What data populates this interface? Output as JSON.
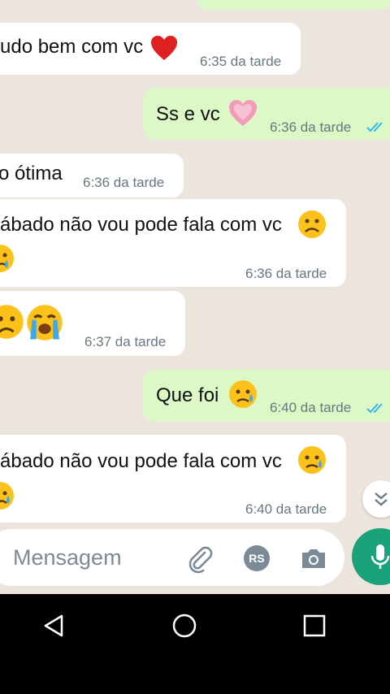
{
  "messages": [
    {
      "direction": "in",
      "text": "udo bem com vc",
      "time": "6:35 da tarde",
      "emoji": "red-heart"
    },
    {
      "direction": "out",
      "text": "Ss e vc",
      "time": "6:36 da tarde",
      "emoji": "growing-heart",
      "status": "read"
    },
    {
      "direction": "in",
      "text": "o ótima",
      "time": "6:36 da tarde"
    },
    {
      "direction": "in",
      "text": "ábado não vou pode fala com vc",
      "time": "6:36 da tarde",
      "emoji": "frowning-face",
      "emoji_line2": "crying-face"
    },
    {
      "direction": "in",
      "text": "",
      "time": "6:37 da tarde",
      "emoji": "sad-face",
      "emoji_2": "loudly-crying-face"
    },
    {
      "direction": "out",
      "text": "Que foi",
      "time": "6:40 da tarde",
      "emoji": "sad-relieved-face",
      "status": "read"
    },
    {
      "direction": "in",
      "text": "ábado não vou pode fala com vc",
      "time": "6:40 da tarde",
      "emoji": "sad-relieved-face",
      "emoji_line2": "sad-relieved-face"
    }
  ],
  "composer": {
    "placeholder": "Mensagem",
    "payment_label": "RS"
  },
  "colors": {
    "chat_background": "#ece5dd",
    "incoming_bubble": "#ffffff",
    "outgoing_bubble": "#dcf8c6",
    "read_ticks": "#34b7f1",
    "mic_button": "#1aa37a"
  }
}
